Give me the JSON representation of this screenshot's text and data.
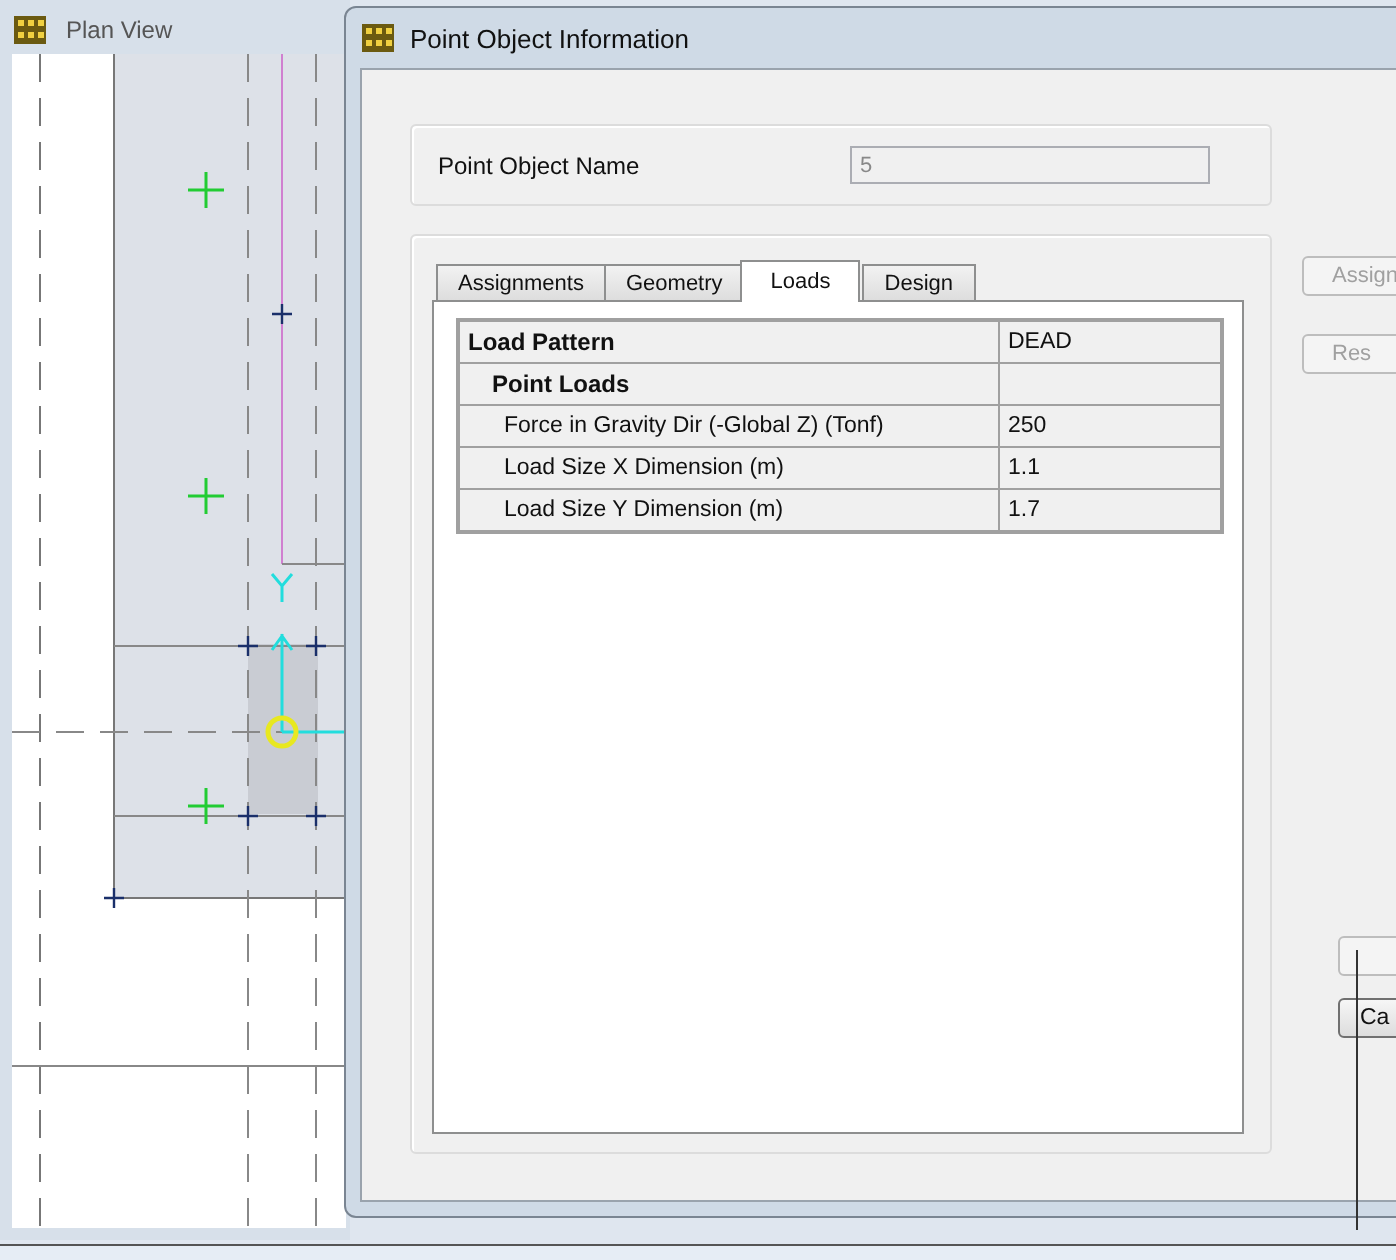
{
  "background_window": {
    "title": "Plan View"
  },
  "dialog": {
    "title": "Point Object Information",
    "name_field": {
      "label": "Point Object Name",
      "value": "5",
      "disabled": true
    },
    "tabs": [
      {
        "label": "Assignments",
        "selected": false
      },
      {
        "label": "Geometry",
        "selected": false
      },
      {
        "label": "Loads",
        "selected": true
      },
      {
        "label": "Design",
        "selected": false
      }
    ],
    "table": {
      "rows": [
        {
          "kind": "header",
          "label": "Load Pattern",
          "value": "DEAD"
        },
        {
          "kind": "section",
          "label": "Point Loads",
          "value": ""
        },
        {
          "kind": "item",
          "label": "Force in Gravity Dir (-Global Z)  (Tonf)",
          "value": "250"
        },
        {
          "kind": "item",
          "label": "Load Size X Dimension  (m)",
          "value": "1.1"
        },
        {
          "kind": "item",
          "label": "Load Size Y Dimension  (m)",
          "value": "1.7"
        }
      ]
    },
    "side_buttons": [
      {
        "label": "Assign",
        "disabled": true
      },
      {
        "label": "Res",
        "disabled": true
      }
    ],
    "bottom_buttons": [
      {
        "disabled": true
      },
      {
        "label": "Ca",
        "disabled": false
      }
    ]
  }
}
